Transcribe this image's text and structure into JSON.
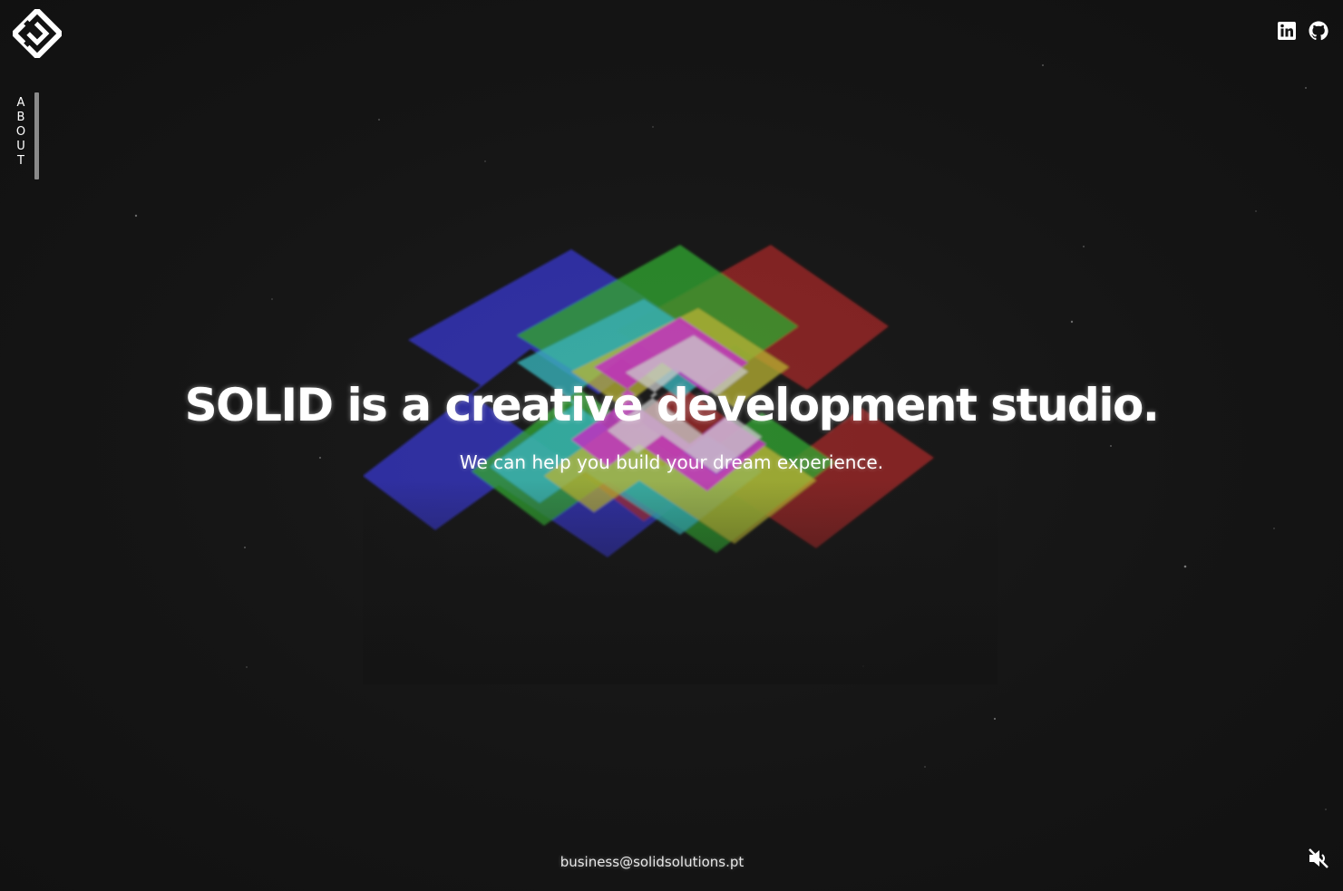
{
  "brand": {
    "logo_icon": "solid-logo-icon"
  },
  "nav": {
    "about_label": "ABOUT"
  },
  "social": [
    {
      "name": "linkedin",
      "icon": "linkedin-icon"
    },
    {
      "name": "github",
      "icon": "github-icon"
    }
  ],
  "hero": {
    "headline": "SOLID is a creative development studio.",
    "subline": "We can help you build your dream experience."
  },
  "footer": {
    "email": "business@solidsolutions.pt",
    "sound_icon": "speaker-muted-icon"
  },
  "colors": {
    "background": "#141414",
    "text": "#ffffff",
    "art_blue": "#2a2ad0",
    "art_red": "#b01818",
    "art_green": "#1fa01f",
    "art_cyan": "#22b0b8",
    "art_yellow": "#b8b020",
    "art_magenta": "#c018c0",
    "art_white": "#c8c8c8"
  }
}
